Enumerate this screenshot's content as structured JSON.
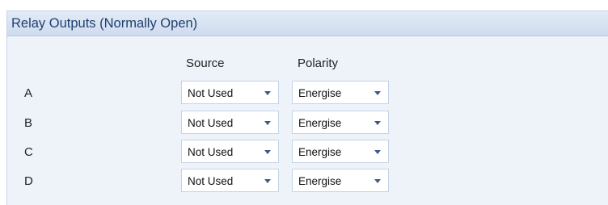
{
  "panel": {
    "title": "Relay Outputs (Normally Open)"
  },
  "columns": {
    "source": "Source",
    "polarity": "Polarity"
  },
  "rows": [
    {
      "label": "A",
      "source": "Not Used",
      "polarity": "Energise"
    },
    {
      "label": "B",
      "source": "Not Used",
      "polarity": "Energise"
    },
    {
      "label": "C",
      "source": "Not Used",
      "polarity": "Energise"
    },
    {
      "label": "D",
      "source": "Not Used",
      "polarity": "Energise"
    }
  ],
  "icons": {
    "dropdown_arrow": "chevron-down-icon"
  },
  "colors": {
    "header_text": "#1f3f6e",
    "panel_bg": "#eef3fa",
    "border": "#c5d3e6"
  }
}
